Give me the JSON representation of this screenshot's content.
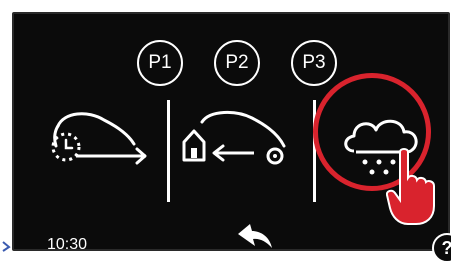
{
  "presets": [
    {
      "label": "P1"
    },
    {
      "label": "P2"
    },
    {
      "label": "P3"
    }
  ],
  "modes": [
    {
      "icon": "timed-departure-icon"
    },
    {
      "icon": "return-home-icon"
    },
    {
      "icon": "rain-sensor-icon"
    }
  ],
  "status": {
    "time": "10:30"
  },
  "controls": {
    "back_icon": "back-arrow-icon",
    "help_label": "?"
  },
  "colors": {
    "screen": "#0b0b0b",
    "foreground": "#ffffff",
    "highlight": "#d9232d"
  }
}
